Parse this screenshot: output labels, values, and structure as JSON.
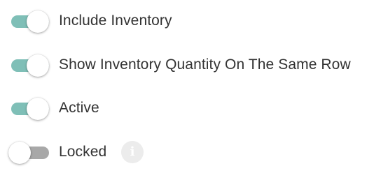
{
  "colors": {
    "toggle_on_track": "#7fbfb7",
    "toggle_off_track": "#a8a8a8",
    "knob": "#ffffff",
    "label_text": "#333333",
    "info_icon_bg": "#ececec"
  },
  "toggles": [
    {
      "label": "Include Inventory",
      "state": "on"
    },
    {
      "label": "Show Inventory Quantity On The Same Row",
      "state": "on"
    },
    {
      "label": "Active",
      "state": "on"
    },
    {
      "label": "Locked",
      "state": "off",
      "info_icon": "info-icon",
      "info_glyph": "i"
    }
  ]
}
